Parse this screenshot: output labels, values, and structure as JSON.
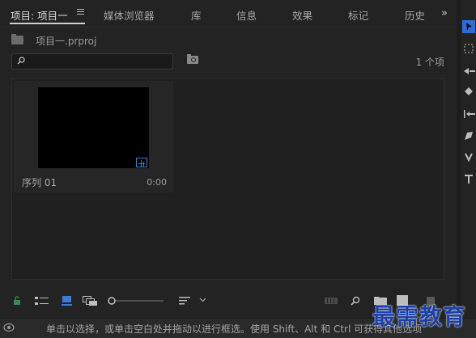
{
  "tabs": [
    {
      "label": "项目: 项目一",
      "active": true
    },
    {
      "label": "媒体浏览器"
    },
    {
      "label": "库"
    },
    {
      "label": "信息"
    },
    {
      "label": "效果"
    },
    {
      "label": "标记"
    },
    {
      "label": "历史"
    }
  ],
  "tabs_overflow": "»",
  "project": {
    "file_name": "项目一.prproj",
    "item_count": "1 个项"
  },
  "search": {
    "value": "",
    "placeholder": ""
  },
  "items": [
    {
      "name": "序列 01",
      "duration": "0:00",
      "thumbnail_color": "#000000",
      "badge_icon": "sequence-icon"
    }
  ],
  "bottom_toolbar": {
    "icons": [
      "lock-icon",
      "list-view-icon",
      "icon-view-icon",
      "freeform-view-icon",
      "zoom-slider",
      "sort-icon",
      "dropdown-chevron-icon",
      "automate-icon",
      "find-icon",
      "new-bin-icon",
      "new-item-icon",
      "clear-icon"
    ],
    "accent": "#2e8f4e",
    "active_view_color": "#3d7ad6"
  },
  "right_tools": [
    "selection-tool-icon",
    "track-select-tool-icon",
    "ripple-edit-tool-icon",
    "razor-tool-icon",
    "slip-tool-icon",
    "pen-tool-icon",
    "hand-tool-icon",
    "type-tool-icon"
  ],
  "status_text": "单击以选择，或单击空白处并拖动以进行框选。使用 Shift、Alt 和 Ctrl 可获得其他选项",
  "watermark": "最需教育",
  "colors": {
    "accent_blue": "#2b6fd6",
    "watermark": "#1d3fa8"
  }
}
